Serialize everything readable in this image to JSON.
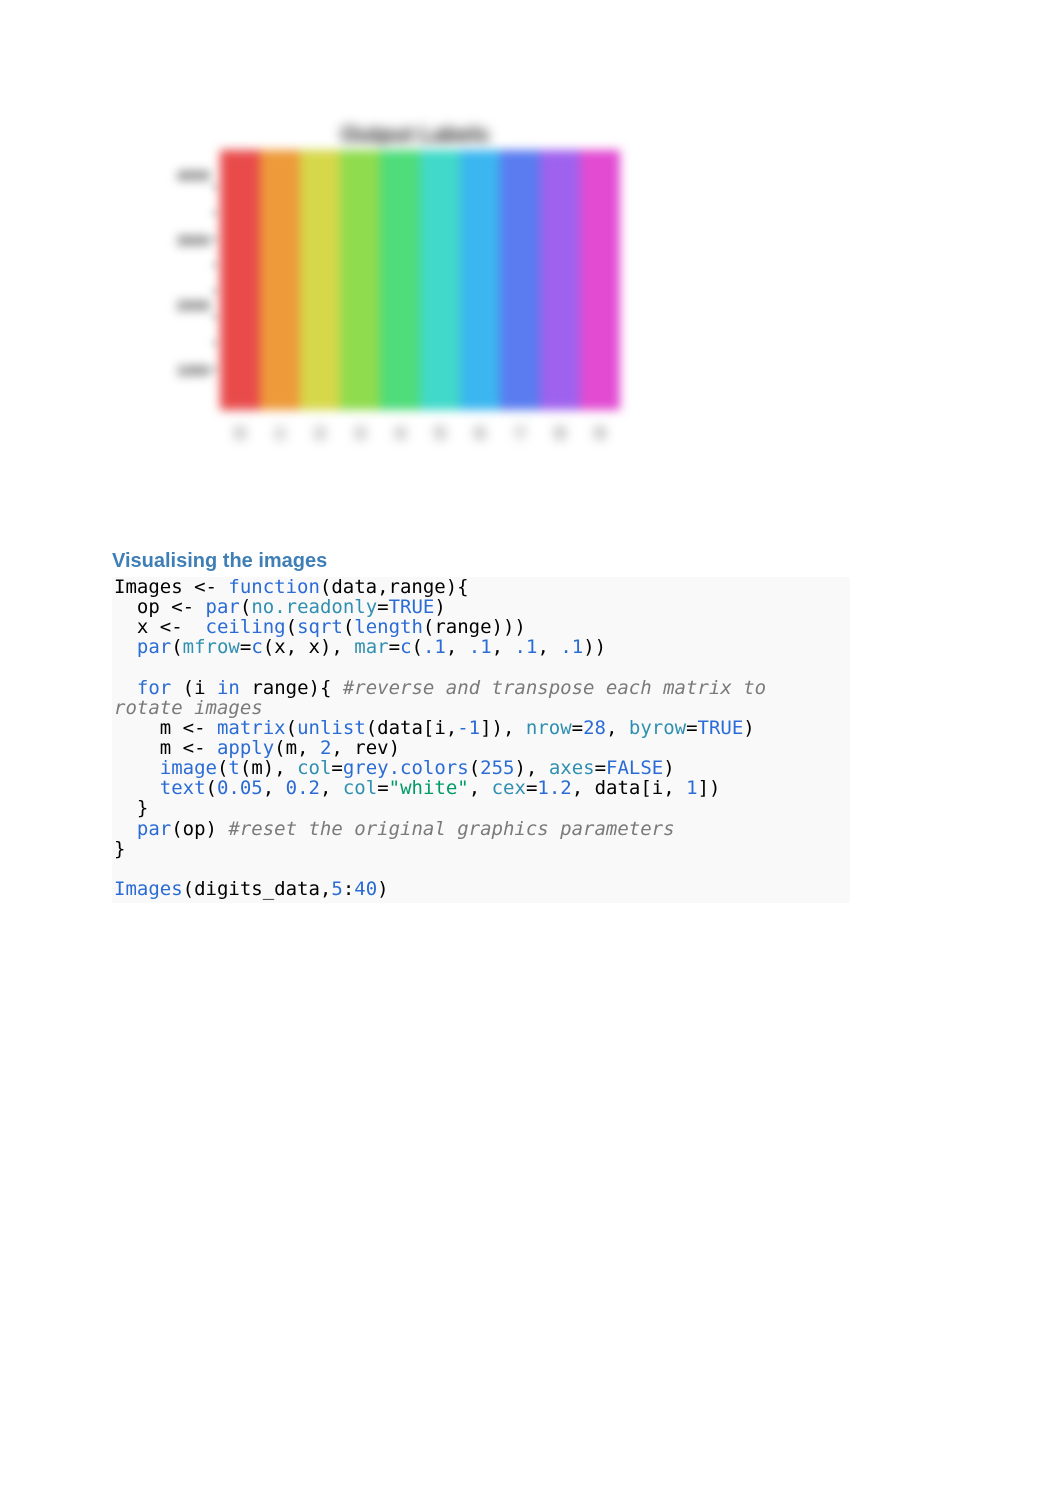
{
  "chart_data": {
    "type": "bar",
    "title": "Output Labels",
    "categories": [
      "0",
      "1",
      "2",
      "3",
      "4",
      "5",
      "6",
      "7",
      "8",
      "9"
    ],
    "y_ticks": [
      "1000",
      "2000",
      "3000",
      "4000"
    ],
    "y_minor_count": 8,
    "bar_colors": [
      "#e94b4b",
      "#ee9a3a",
      "#d6d84a",
      "#8fdc4e",
      "#4fdc7a",
      "#41d9c9",
      "#3bb6f0",
      "#5a7cf0",
      "#9f62ee",
      "#e24bd2"
    ],
    "xlabel": "",
    "ylabel": "",
    "ylim": [
      0,
      4500
    ]
  },
  "section": {
    "heading": "Visualising the images"
  },
  "code": {
    "t01": "Images <- ",
    "t02": "function",
    "t03": "(data,range){",
    "t04": "  op <- ",
    "t05": "par",
    "t06": "(",
    "t07": "no.readonly",
    "t08": "=",
    "t09": "TRUE",
    "t10": ")",
    "t11": "  x <-  ",
    "t12": "ceiling",
    "t13": "(",
    "t14": "sqrt",
    "t15": "(",
    "t16": "length",
    "t17": "(range)))",
    "t18": "  ",
    "t19": "par",
    "t20": "(",
    "t21": "mfrow",
    "t22": "=",
    "t23": "c",
    "t24": "(x, x), ",
    "t25": "mar",
    "t26": "=",
    "t27": "c",
    "t28": "(",
    "t29": ".1",
    "t30": ", ",
    "t31": ".1",
    "t32": ", ",
    "t33": ".1",
    "t34": ", ",
    "t35": ".1",
    "t36": "))",
    "t37": "",
    "t38": "  ",
    "t39": "for",
    "t40": " (i ",
    "t41": "in",
    "t42": " range){ ",
    "t43": "#reverse and transpose each matrix to rotate images",
    "t44": "    m <- ",
    "t45": "matrix",
    "t46": "(",
    "t47": "unlist",
    "t48": "(data[i,",
    "t49": "-1",
    "t50": "]), ",
    "t51": "nrow",
    "t52": "=",
    "t53": "28",
    "t54": ", ",
    "t55": "byrow",
    "t56": "=",
    "t57": "TRUE",
    "t58": ")",
    "t59": "    m <- ",
    "t60": "apply",
    "t61": "(m, ",
    "t62": "2",
    "t63": ", rev)",
    "t64": "    ",
    "t65": "image",
    "t66": "(",
    "t67": "t",
    "t68": "(m), ",
    "t69": "col",
    "t70": "=",
    "t71": "grey.colors",
    "t72": "(",
    "t73": "255",
    "t74": "), ",
    "t75": "axes",
    "t76": "=",
    "t77": "FALSE",
    "t78": ")",
    "t79": "    ",
    "t80": "text",
    "t81": "(",
    "t82": "0.05",
    "t83": ", ",
    "t84": "0.2",
    "t85": ", ",
    "t86": "col",
    "t87": "=",
    "t88": "\"white\"",
    "t89": ", ",
    "t90": "cex",
    "t91": "=",
    "t92": "1.2",
    "t93": ", data[i, ",
    "t94": "1",
    "t95": "])",
    "t96": "  }",
    "t97": "  ",
    "t98": "par",
    "t99": "(op) ",
    "t100": "#reset the original graphics parameters",
    "t101": "}",
    "t102": "",
    "t103": "Images",
    "t104": "(digits_data,",
    "t105": "5",
    "t106": ":",
    "t107": "40",
    "t108": ")"
  }
}
